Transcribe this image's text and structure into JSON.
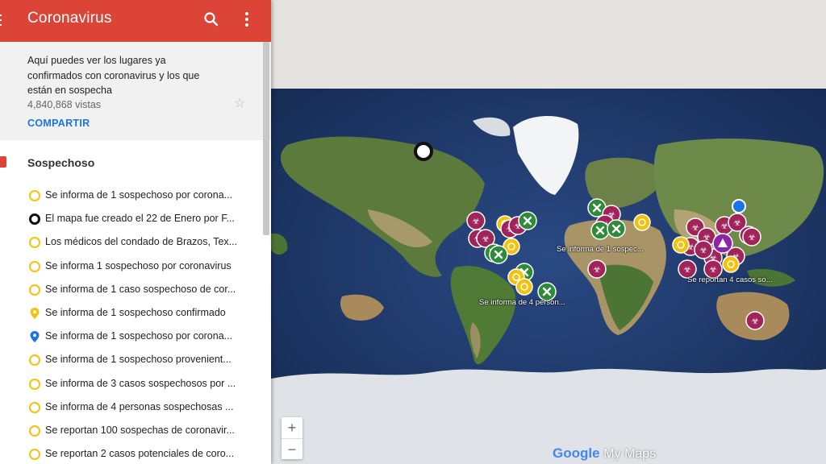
{
  "app": {
    "title": "Coronavirus",
    "description": "Aquí puedes ver los lugares ya confirmados con coronavirus y los que están en sospecha",
    "views": "4,840,868 vistas",
    "share_label": "COMPARTIR"
  },
  "layer": {
    "name": "Sospechoso",
    "items": [
      {
        "label": "Se informa de 1 sospechoso por corona...",
        "icon": "yellow-ring-icon"
      },
      {
        "label": "El mapa fue creado el 22 de Enero por F...",
        "icon": "black-ring-icon"
      },
      {
        "label": "Los médicos del condado de Brazos, Tex...",
        "icon": "yellow-ring-icon"
      },
      {
        "label": "Se informa 1 sospechoso por coronavirus",
        "icon": "yellow-ring-icon"
      },
      {
        "label": "Se informa de 1 caso sospechoso de cor...",
        "icon": "yellow-ring-icon"
      },
      {
        "label": "Se informa de 1 sospechoso confirmado",
        "icon": "yellow-pin-icon"
      },
      {
        "label": "Se informa de 1 sospechoso por corona...",
        "icon": "blue-pin-icon"
      },
      {
        "label": "Se informa de 1 sospechoso provenient...",
        "icon": "yellow-ring-icon"
      },
      {
        "label": "Se informa de 3 casos sospechosos por ...",
        "icon": "yellow-ring-icon"
      },
      {
        "label": "Se informa de 4 personas sospechosas ...",
        "icon": "yellow-ring-icon"
      },
      {
        "label": "Se reportan 100 sospechas de coronavir...",
        "icon": "yellow-ring-icon"
      },
      {
        "label": "Se reportan 2 casos potenciales de coro...",
        "icon": "yellow-ring-icon"
      }
    ]
  },
  "map": {
    "labels": {
      "africa": "Se informa de 1 sospec...",
      "southamerica": "Se informa de 4 person...",
      "asia": "Se reportan 4 casos so..."
    },
    "zoom_in": "+",
    "zoom_out": "−",
    "logo_google": "Google",
    "logo_mymaps": "My Maps"
  },
  "colors": {
    "accent": "#db4437",
    "biohazard": "#a0245a",
    "cross": "#2e8b3a",
    "suspect": "#f4c20d",
    "ocean": "#223c6e"
  }
}
